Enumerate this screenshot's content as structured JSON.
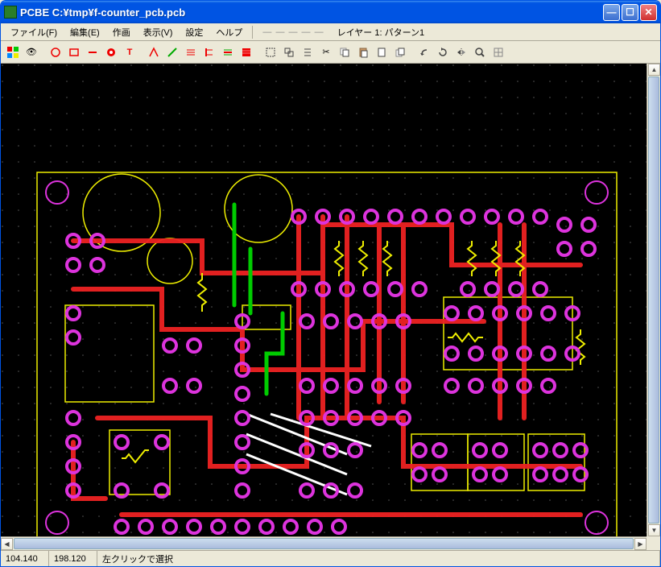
{
  "title": "PCBE   C:¥tmp¥f-counter_pcb.pcb",
  "menu": {
    "file": "ファイル(F)",
    "edit": "編集(E)",
    "make": "作画",
    "view": "表示(V)",
    "settings": "設定",
    "help": "ヘルプ"
  },
  "layer_label": "レイヤー 1: パターン1",
  "status": {
    "x": "104.140",
    "y": "198.120",
    "msg": "左クリックで選択"
  },
  "tools": {
    "t1": "layer-palette",
    "t2": "eye",
    "t3": "circle",
    "t4": "rect",
    "t5": "line-h",
    "t6": "pad",
    "t7": "text",
    "t8": "arrow",
    "t9": "diag",
    "t10": "lines",
    "t11": "align-l",
    "t12": "align-c",
    "t13": "grid-red",
    "t14": "select",
    "t15": "group",
    "t16": "list",
    "t17": "cut",
    "t18": "copy",
    "t19": "paste",
    "t20": "new",
    "t21": "dup",
    "t22": "rot-l",
    "t23": "rot-r",
    "t24": "flip",
    "t25": "zoom",
    "t26": "grid-view"
  }
}
